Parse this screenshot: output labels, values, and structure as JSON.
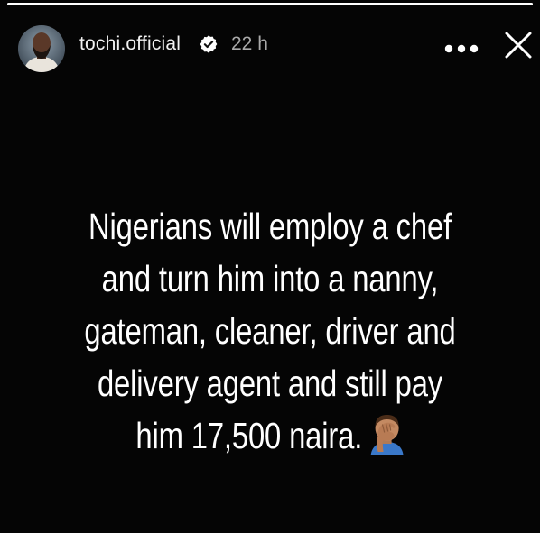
{
  "story": {
    "progress": 1.0,
    "progress_color": "#ffffff"
  },
  "header": {
    "username": "tochi.official",
    "verified": true,
    "time": "22 h",
    "more_icon": "more-horizontal-icon",
    "close_icon": "close-icon",
    "avatar_icon": "profile-avatar"
  },
  "caption": {
    "lines": [
      "Nigerians will employ a chef",
      "and turn him into a nanny,",
      "gateman, cleaner, driver and",
      "delivery agent and still pay",
      "him 17,500 naira."
    ],
    "emoji_icon": "man-facepalming-emoji"
  }
}
